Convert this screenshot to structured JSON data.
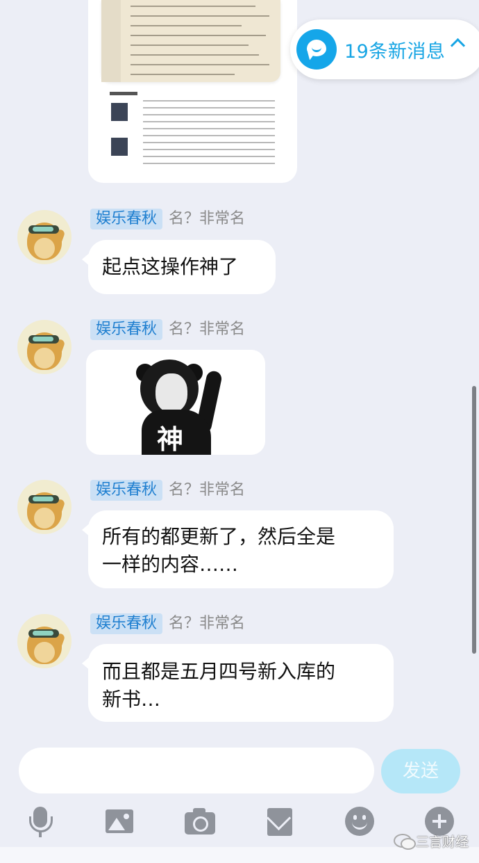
{
  "new_messages": {
    "label": "19条新消息"
  },
  "messages": [
    {
      "sender_tag": "娱乐春秋",
      "sender_nick": "名？非常名",
      "text_lines": [
        "起点这操作神了"
      ]
    },
    {
      "sender_tag": "娱乐春秋",
      "sender_nick": "名？非常名",
      "sticker": {
        "caption": "神"
      }
    },
    {
      "sender_tag": "娱乐春秋",
      "sender_nick": "名？非常名",
      "text_lines": [
        "所有的都更新了，然后全是",
        "一样的内容……"
      ]
    },
    {
      "sender_tag": "娱乐春秋",
      "sender_nick": "名？非常名",
      "text_lines": [
        "而且都是五月四号新入库的",
        "新书…"
      ]
    }
  ],
  "composer": {
    "placeholder": "",
    "send_label": "发送"
  },
  "toolbar": [
    "mic-icon",
    "image-icon",
    "camera-icon",
    "red-packet-icon",
    "emoji-icon",
    "plus-icon"
  ],
  "watermark": {
    "text": "三言财经"
  }
}
